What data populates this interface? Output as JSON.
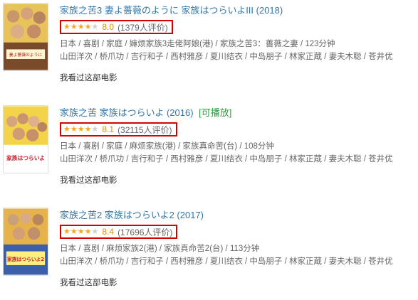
{
  "movies": [
    {
      "title": "家族之苦3 妻よ薔薇のように 家族はつらいよIII (2018)",
      "playable": "",
      "stars": 4,
      "rating": "8.0",
      "count": "(1379人评价)",
      "meta": "日本 / 喜剧 / 家庭 / 嫲烦家族3走佬阿娘(港) / 家族之苦3：薔薇之妻 / 123分钟",
      "cast": "山田洋次 / 桥爪功 / 吉行和子 / 西村雅彦 / 夏川结衣 / 中岛朋子 / 林家正蔵 / 妻夫木聪 / 苍井优",
      "seen": "我看过这部电影"
    },
    {
      "title": "家族之苦 家族はつらいよ (2016)",
      "playable": "[可播放]",
      "stars": 4,
      "rating": "8.1",
      "count": "(32115人评价)",
      "meta": "日本 / 喜剧 / 家庭 / 麻烦家族(港) / 家族真命苦(台) / 108分钟",
      "cast": "山田洋次 / 桥爪功 / 吉行和子 / 西村雅彦 / 夏川结衣 / 中岛朋子 / 林家正蔵 / 妻夫木聪 / 苍井优",
      "seen": "我看过这部电影"
    },
    {
      "title": "家族之苦2 家族はつらいよ2 (2017)",
      "playable": "",
      "stars": 4,
      "rating": "8.4",
      "count": "(17696人评价)",
      "meta": "日本 / 喜剧 / 麻烦家族2(港) / 家族真命苦2(台) / 113分钟",
      "cast": "山田洋次 / 桥爪功 / 吉行和子 / 西村雅彦 / 夏川结衣 / 中岛朋子 / 林家正蔵 / 妻夫木聪 / 苍井优",
      "seen": "我看过这部电影"
    }
  ],
  "posters": [
    {
      "caption": "妻よ薔薇のように",
      "bg": "#e8c35a"
    },
    {
      "caption": "家族はつらいよ",
      "bg": "#f2d34a"
    },
    {
      "caption": "家族はつらいよ2",
      "bg": "#e6b24a"
    }
  ],
  "colors": {
    "link": "#3377aa",
    "highlight_box": "#d40000",
    "star": "#f5a623",
    "playable": "#2a9a3b"
  }
}
